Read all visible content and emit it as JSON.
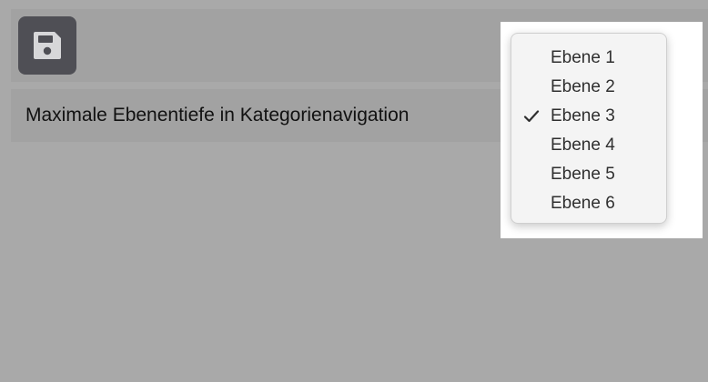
{
  "toolbar": {
    "save_icon": "floppy-disk-icon",
    "button_color": "#4f4f55"
  },
  "setting": {
    "label": "Maximale Ebenentiefe in Kategorienavigation"
  },
  "dropdown": {
    "selected": "Ebene 3",
    "options": [
      {
        "label": "Ebene 1",
        "checked": false
      },
      {
        "label": "Ebene 2",
        "checked": false
      },
      {
        "label": "Ebene 3",
        "checked": true
      },
      {
        "label": "Ebene 4",
        "checked": false
      },
      {
        "label": "Ebene 5",
        "checked": false
      },
      {
        "label": "Ebene 6",
        "checked": false
      }
    ],
    "check_icon": "checkmark-icon"
  }
}
